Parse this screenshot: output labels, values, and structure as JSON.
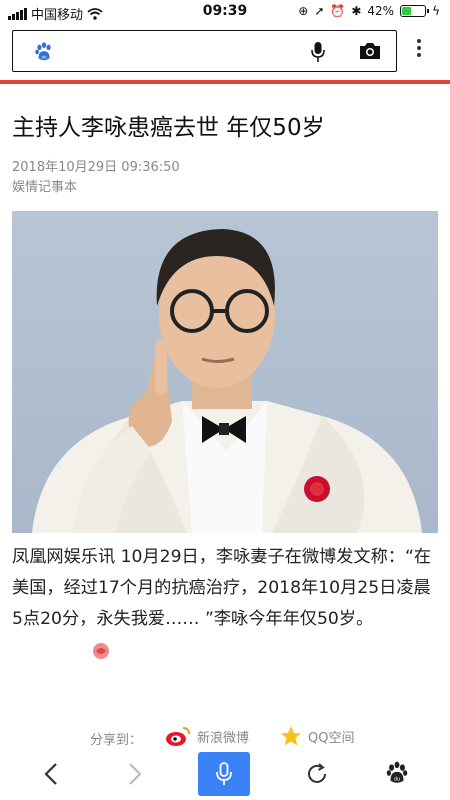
{
  "status_bar": {
    "carrier": "中国移动",
    "time": "09:39",
    "battery": "42%",
    "battery_level": 0.42
  },
  "search_bar": {
    "logo_icon": "baidu-paw-icon",
    "mic_icon": "microphone-icon",
    "camera_icon": "camera-icon",
    "more_icon": "more-vertical-icon",
    "accent": "#e0453a"
  },
  "article": {
    "title": "主持人李咏患癌去世 年仅50岁",
    "datetime": "2018年10月29日 09:36:50",
    "source": "娱情记事本",
    "body": "凤凰网娱乐讯 10月29日，李咏妻子在微博发文称：“在美国，经过17个月的抗癌治疗，2018年10月25日凌晨5点20分，永失我爱…… ”李咏今年年仅50岁。"
  },
  "share": {
    "label": "分享到：",
    "weibo": "新浪微博",
    "qzone": "QQ空间"
  },
  "toolbar": {
    "back_icon": "chevron-left-icon",
    "forward_icon": "chevron-right-icon",
    "voice_icon": "microphone-icon",
    "refresh_icon": "refresh-icon",
    "home_icon": "baidu-paw-icon",
    "voice_color": "#3b82f6"
  }
}
